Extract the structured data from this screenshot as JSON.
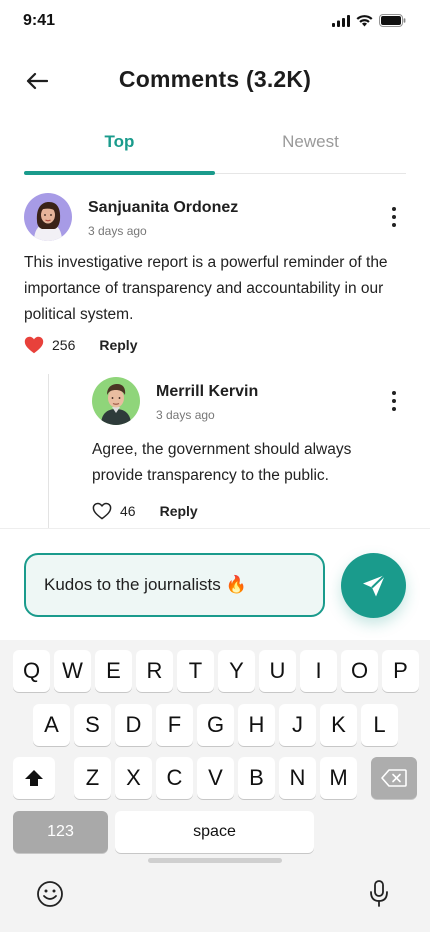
{
  "status_bar": {
    "time": "9:41"
  },
  "header": {
    "title": "Comments (3.2K)"
  },
  "tabs": [
    {
      "label": "Top",
      "active": true
    },
    {
      "label": "Newest",
      "active": false
    }
  ],
  "colors": {
    "accent": "#1a9b8c",
    "like_red": "#e8413b"
  },
  "comments": [
    {
      "author": "Sanjuanita Ordonez",
      "time": "3 days ago",
      "text": "This investigative report is a powerful reminder of the importance of transparency and accountability in our political system.",
      "likes": "256",
      "liked": true,
      "reply_label": "Reply"
    },
    {
      "author": "Merrill Kervin",
      "time": "3 days ago",
      "text": "Agree, the government should always provide transparency to the public.",
      "likes": "46",
      "liked": false,
      "reply_label": "Reply"
    }
  ],
  "composer": {
    "value": "Kudos to the journalists 🔥"
  },
  "keyboard": {
    "row1": [
      "Q",
      "W",
      "E",
      "R",
      "T",
      "Y",
      "U",
      "I",
      "O",
      "P"
    ],
    "row2": [
      "A",
      "S",
      "D",
      "F",
      "G",
      "H",
      "J",
      "K",
      "L"
    ],
    "row3": [
      "Z",
      "X",
      "C",
      "V",
      "B",
      "N",
      "M"
    ],
    "numbers_label": "123",
    "space_label": "space"
  }
}
